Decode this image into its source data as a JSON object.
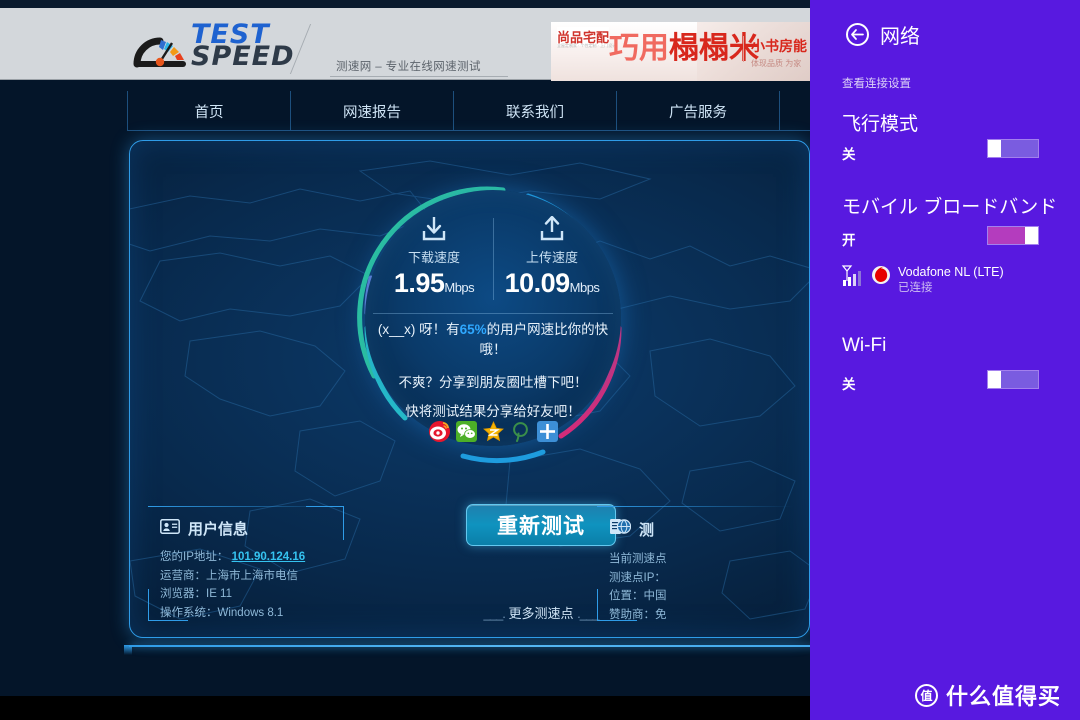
{
  "site": {
    "logo_primary": "TEST",
    "logo_secondary": "SPEED",
    "tagline": "测速网 – 专业在线网速测试",
    "nav": [
      {
        "label": "首页"
      },
      {
        "label": "网速报告"
      },
      {
        "label": "联系我们"
      },
      {
        "label": "广告服务"
      }
    ]
  },
  "banner": {
    "brand": "尚品宅配",
    "brand_sub": "全屋定制家 · 个性定制 · 上门设计",
    "headline_light": "巧用",
    "headline_bold": "榻榻米",
    "right_line1": "小书房能",
    "right_line2": "体现品质 为家"
  },
  "result": {
    "download": {
      "icon": "download-arrow-icon",
      "label": "下载速度",
      "value": "1.95",
      "unit": "Mbps"
    },
    "upload": {
      "icon": "upload-arrow-icon",
      "label": "上传速度",
      "value": "10.09",
      "unit": "Mbps"
    },
    "message_prefix": "(x__x) 呀！有",
    "message_percent": "65%",
    "message_suffix": "的用户网速比你的快哦！",
    "message_2": "不爽？分享到朋友圈吐槽下吧！",
    "message_3": "快将测试结果分享给好友吧！",
    "socials": [
      {
        "name": "weibo-share-icon",
        "color": "#e6162d"
      },
      {
        "name": "wechat-share-icon",
        "color": "#4caf27"
      },
      {
        "name": "qzone-share-icon",
        "color": "#f5b301"
      },
      {
        "name": "pinterest-share-icon",
        "color": "#3a8f4a"
      },
      {
        "name": "more-share-icon",
        "color": "#3d8fd6"
      }
    ],
    "retest_button": "重新测试",
    "more_points_dash_left": "___.",
    "more_points": "更多测速点",
    "more_points_dash_right": ".___",
    "arc_colors": {
      "top_green": "#2ecc9a",
      "right_blue": "#1f9fe0",
      "bottom_pink": "#f0216e",
      "left_cyan": "#28c8c8",
      "left_violet": "#6a7fd6"
    }
  },
  "user_info": {
    "icon": "id-card-icon",
    "title": "用户信息",
    "lines": [
      {
        "label": "您的IP地址：",
        "value": "101.90.124.16",
        "is_link": true
      },
      {
        "label": "运营商：上海市上海市电信",
        "value": "",
        "is_link": false
      },
      {
        "label": "浏览器：IE 11",
        "value": "",
        "is_link": false
      },
      {
        "label": "操作系统：Windows 8.1",
        "value": "",
        "is_link": false
      }
    ]
  },
  "server_info": {
    "icon": "globe-doc-icon",
    "title": "测",
    "lines": [
      {
        "label": "当前测速点"
      },
      {
        "label": "测速点IP："
      },
      {
        "label": "位置：中国"
      },
      {
        "label": "赞助商：免"
      }
    ]
  },
  "charms": {
    "back_icon": "back-arrow-icon",
    "title": "网络",
    "view_settings_link": "查看连接设置",
    "sections": [
      {
        "name": "airplane-mode",
        "title": "飞行模式",
        "state_label": "关",
        "on": false
      },
      {
        "name": "mobile-broadband",
        "title": "モバイル ブロードバンド",
        "state_label": "开",
        "on": true
      },
      {
        "name": "wifi",
        "title": "Wi-Fi",
        "state_label": "关",
        "on": false
      }
    ],
    "connection": {
      "signal_icon": "signal-bars-icon",
      "carrier_icon": "vodafone-icon",
      "name": "Vodafone NL (LTE)",
      "status": "已连接"
    },
    "toggle_on_color": "#b43cbe",
    "toggle_off_color": "#7a5ce0",
    "panel_color": "#5819e0"
  },
  "watermark": {
    "badge": "值",
    "text": "什么值得买"
  }
}
